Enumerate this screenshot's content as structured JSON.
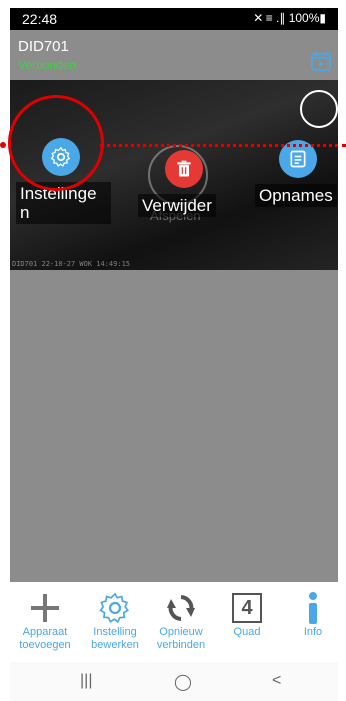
{
  "status_bar": {
    "time": "22:48",
    "indicators": "✕ ≡ .∥ 100%▮"
  },
  "device": {
    "name": "DID701",
    "status": "Verbonden"
  },
  "video": {
    "ghost_label": "Afspelen",
    "watermark": "DID701   22-10-27 WOK 14:49:15"
  },
  "actions": {
    "settings": {
      "label": "Instellinge n",
      "icon": "gear-icon"
    },
    "delete": {
      "label": "Verwijder",
      "icon": "trash-icon"
    },
    "recordings": {
      "label": "Opnames",
      "icon": "list-icon"
    }
  },
  "toolbar": {
    "add": {
      "line1": "Apparaat",
      "line2": "toevoegen"
    },
    "edit": {
      "line1": "Instelling",
      "line2": "bewerken"
    },
    "reconnect": {
      "line1": "Opnieuw",
      "line2": "verbinden"
    },
    "quad": {
      "line1": "Quad",
      "line2": "",
      "digit": "4"
    },
    "info": {
      "line1": "Info",
      "line2": ""
    }
  },
  "colors": {
    "accent": "#4aa8e8",
    "connected": "#3fd23f",
    "highlight": "#e00000",
    "delete": "#e53935"
  }
}
